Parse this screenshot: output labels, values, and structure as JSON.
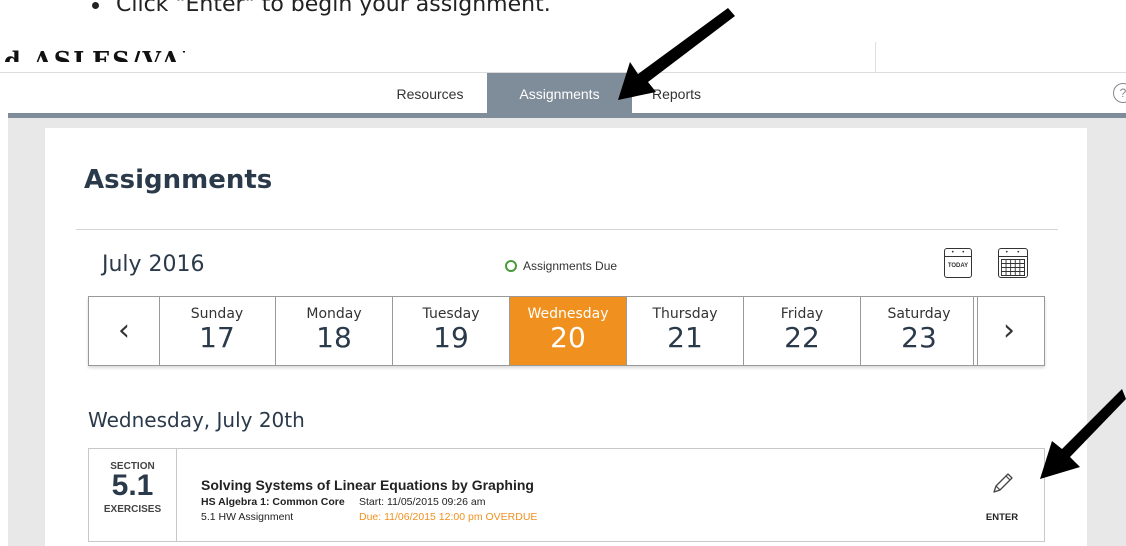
{
  "instruction": {
    "text": "Click \"Enter\" to begin your assignment."
  },
  "logo": {
    "text": "d ASLES/VALL"
  },
  "nav": {
    "tabs": [
      {
        "label": "Resources"
      },
      {
        "label": "Assignments",
        "active": true
      },
      {
        "label": "Reports"
      }
    ],
    "help_label": "?"
  },
  "page": {
    "title": "Assignments"
  },
  "calendar": {
    "month": "July 2016",
    "legend": "Assignments Due",
    "today_label": "TODAY",
    "prev_label": "‹",
    "next_label": "›",
    "days": [
      {
        "name": "Sunday",
        "date": "17"
      },
      {
        "name": "Monday",
        "date": "18"
      },
      {
        "name": "Tuesday",
        "date": "19"
      },
      {
        "name": "Wednesday",
        "date": "20",
        "active": true
      },
      {
        "name": "Thursday",
        "date": "21"
      },
      {
        "name": "Friday",
        "date": "22"
      },
      {
        "name": "Saturday",
        "date": "23"
      }
    ]
  },
  "date_heading": "Wednesday, July 20th",
  "assignment": {
    "section_label": "SECTION",
    "section_number": "5.1",
    "exercises_label": "EXERCISES",
    "title": "Solving Systems of Linear Equations by Graphing",
    "course": "HS Algebra 1: Common Core",
    "type": "5.1 HW Assignment",
    "start": "Start: 11/05/2015 09:26 am",
    "due": "Due: 11/06/2015 12:00 pm OVERDUE",
    "enter_label": "ENTER"
  },
  "colors": {
    "accent": "#f0901e",
    "nav_active": "#7f8c99",
    "due_dot": "#4a9a3b",
    "title": "#2b3a4a"
  },
  "icons": [
    "bullet-icon",
    "help-icon",
    "today-calendar-icon",
    "month-calendar-icon",
    "chevron-left-icon",
    "chevron-right-icon",
    "pencil-icon",
    "arrow-pointer-icon"
  ]
}
